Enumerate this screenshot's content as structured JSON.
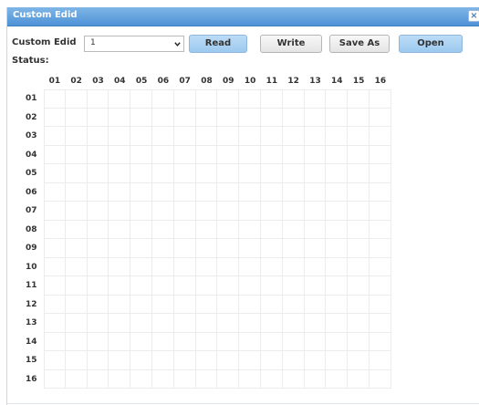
{
  "dialog": {
    "title": "Custom Edid",
    "close_glyph": "×"
  },
  "form": {
    "custom_edid_label": "Custom Edid",
    "select_value": "1",
    "status_label": "Status:"
  },
  "buttons": {
    "read": "Read",
    "write": "Write",
    "save_as": "Save As",
    "open": "Open"
  },
  "table": {
    "column_headers": [
      "01",
      "02",
      "03",
      "04",
      "05",
      "06",
      "07",
      "08",
      "09",
      "10",
      "11",
      "12",
      "13",
      "14",
      "15",
      "16"
    ],
    "row_headers": [
      "01",
      "02",
      "03",
      "04",
      "05",
      "06",
      "07",
      "08",
      "09",
      "10",
      "11",
      "12",
      "13",
      "14",
      "15",
      "16"
    ]
  },
  "colors": {
    "title_bar": "#5a9bdc",
    "primary_button": "#a8d0f2",
    "grid_line": "#ececec"
  },
  "icons": {
    "close": "close-icon",
    "dropdown": "chevron-down-icon"
  }
}
